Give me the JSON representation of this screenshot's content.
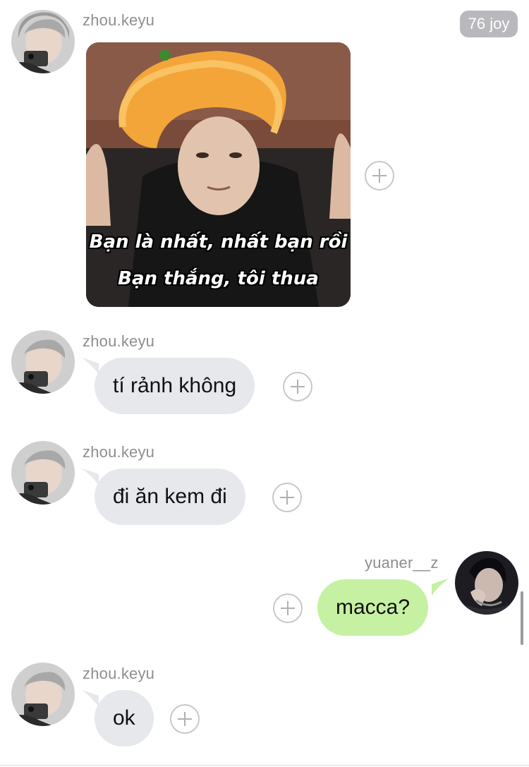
{
  "badge": {
    "text": "76 joy"
  },
  "messages": [
    {
      "sender": "zhou.keyu",
      "type": "sticker",
      "caption_line1": "Bạn là nhất, nhất bạn rồi",
      "caption_line2": "Bạn thắng, tôi thua"
    },
    {
      "sender": "zhou.keyu",
      "type": "text",
      "text": "tí rảnh không"
    },
    {
      "sender": "zhou.keyu",
      "type": "text",
      "text": "đi ăn kem đi"
    },
    {
      "sender": "yuaner__z",
      "type": "text",
      "text": "macca?"
    },
    {
      "sender": "zhou.keyu",
      "type": "text",
      "text": "ok"
    }
  ],
  "colors": {
    "incoming_bubble": "#e6e8ec",
    "outgoing_bubble": "#c6f0a2",
    "username": "#8e8e93",
    "badge": "#b9b9bd"
  },
  "icons": {
    "add_reaction": "plus-circle-icon"
  }
}
